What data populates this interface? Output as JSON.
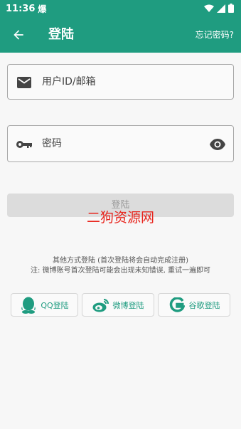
{
  "status_bar": {
    "time": "11:36",
    "notif_glyph": "爆",
    "icons": [
      "wifi-icon",
      "signal-icon",
      "battery-icon"
    ]
  },
  "appbar": {
    "title": "登陆",
    "forgot_label": "忘记密码?",
    "back_icon": "arrow-left-icon",
    "color": "#1f9c80"
  },
  "form": {
    "username": {
      "placeholder": "用户ID/邮箱",
      "value": "",
      "icon": "email-icon"
    },
    "password": {
      "placeholder": "密码",
      "value": "",
      "icon": "key-icon",
      "toggle_icon": "eye-icon"
    },
    "login_label": "登陆"
  },
  "watermark": "二狗资源网",
  "info": {
    "line1": "其他方式登陆 (首次登陆将会自动完成注册)",
    "line2": "注: 微博账号首次登陆可能会出现未知错误, 重试一遍即可"
  },
  "social": {
    "qq_label": "QQ登陆",
    "weibo_label": "微博登陆",
    "google_label": "谷歌登陆"
  }
}
